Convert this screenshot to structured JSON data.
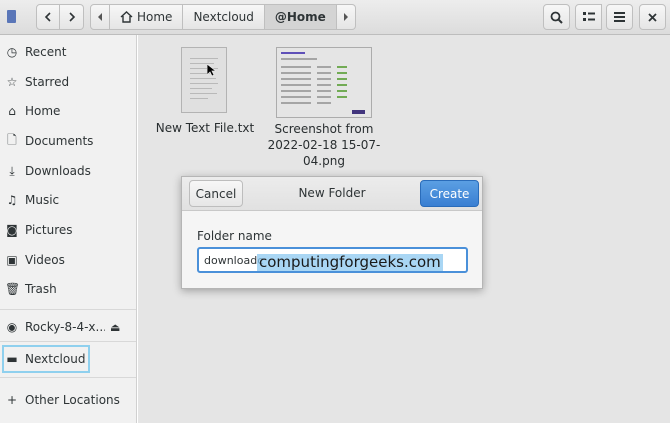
{
  "header": {
    "path": [
      "Home",
      "Nextcloud",
      "@Home"
    ]
  },
  "sidebar": {
    "items": [
      {
        "label": "Recent",
        "icon": "clock-icon"
      },
      {
        "label": "Starred",
        "icon": "star-icon"
      },
      {
        "label": "Home",
        "icon": "home-icon"
      },
      {
        "label": "Documents",
        "icon": "document-icon"
      },
      {
        "label": "Downloads",
        "icon": "download-icon"
      },
      {
        "label": "Music",
        "icon": "music-icon"
      },
      {
        "label": "Pictures",
        "icon": "camera-icon"
      },
      {
        "label": "Videos",
        "icon": "video-icon"
      },
      {
        "label": "Trash",
        "icon": "trash-icon"
      }
    ],
    "devices": [
      {
        "label": "Rocky-8-4-x...",
        "icon": "disc-icon"
      }
    ],
    "network": [
      {
        "label": "Nextcloud",
        "icon": "folder-icon"
      }
    ],
    "other": {
      "label": "Other Locations",
      "icon": "plus-icon"
    }
  },
  "files": [
    {
      "name_line1": "New Text File.txt",
      "name_line2": "",
      "name_line3": ""
    },
    {
      "name_line1": "Screenshot from",
      "name_line2": "2022-02-18 15-07-",
      "name_line3": "04.png"
    }
  ],
  "dialog": {
    "title": "New Folder",
    "cancel_label": "Cancel",
    "create_label": "Create",
    "field_label": "Folder name",
    "field_value": "downloadc"
  },
  "watermark": "computingforgeeks.com"
}
